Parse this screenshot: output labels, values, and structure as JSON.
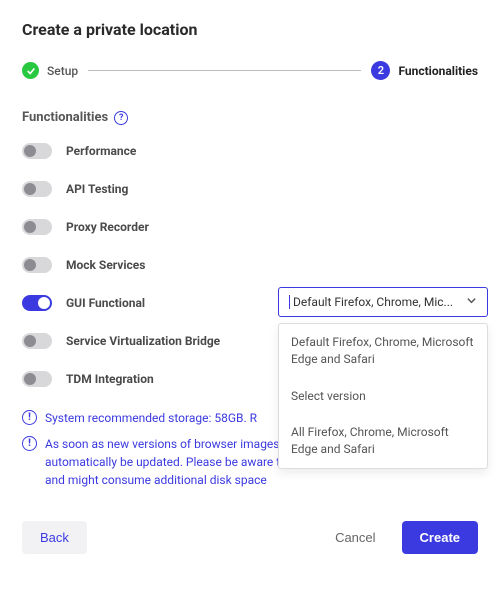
{
  "title": "Create a private location",
  "stepper": {
    "step1_label": "Setup",
    "step2_num": "2",
    "step2_label": "Functionalities"
  },
  "section_title": "Functionalities",
  "toggles": {
    "performance": "Performance",
    "api_testing": "API Testing",
    "proxy_recorder": "Proxy Recorder",
    "mock_services": "Mock Services",
    "gui_functional": "GUI Functional",
    "svb": "Service Virtualization Bridge",
    "tdm": "TDM Integration"
  },
  "select": {
    "value": "Default Firefox, Chrome, Mic...",
    "options": {
      "opt1": "Default Firefox, Chrome, Microsoft Edge and Safari",
      "opt2": "Select version",
      "opt3": "All Firefox, Chrome, Microsoft Edge and Safari"
    }
  },
  "info": {
    "storage": "System recommended storage: 58GB. R",
    "browser_update": "As soon as new versions of browser images are available, the location will automatically be updated. Please be aware that this will cause network traffic and might consume additional disk space"
  },
  "buttons": {
    "back": "Back",
    "cancel": "Cancel",
    "create": "Create"
  }
}
